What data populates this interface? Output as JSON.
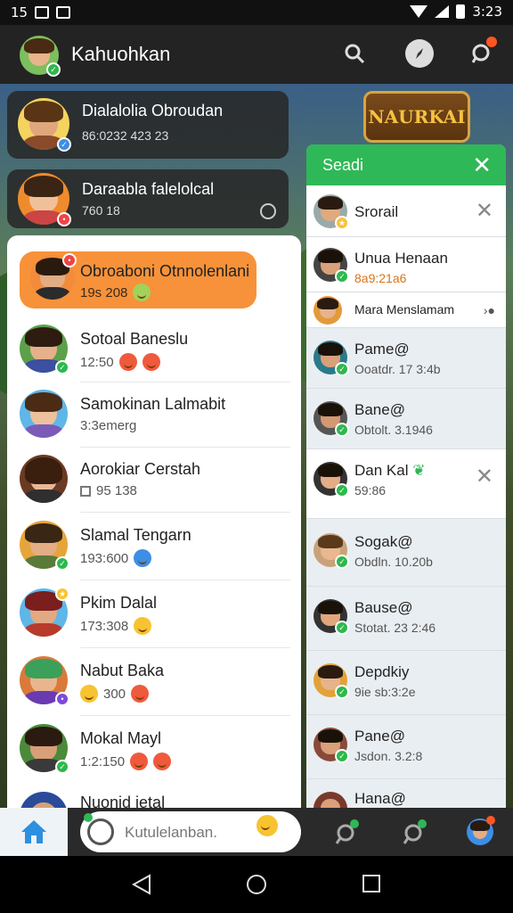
{
  "status": {
    "left_num": "15",
    "time": "3:23"
  },
  "appbar": {
    "title": "Kahuohkan"
  },
  "scene": {
    "sign_text": "NAURKAI"
  },
  "float_cards": [
    {
      "name": "Dialalolia Obroudan",
      "sub": "86:0232 423 23"
    },
    {
      "name": "Daraabla falelolcal",
      "sub": "760 18"
    }
  ],
  "chat_list": [
    {
      "name": "Obroaboni Otnnolenlani",
      "sub": "19s 208"
    },
    {
      "name": "Sotoal Baneslu",
      "sub": "12:50"
    },
    {
      "name": "Samokinan Lalmabit",
      "sub": "3:3emerg"
    },
    {
      "name": "Aorokiar Cerstah",
      "sub": "95 138"
    },
    {
      "name": "Slamal Tengarn",
      "sub": "193:600"
    },
    {
      "name": "Pkim Dalal",
      "sub": "173:308"
    },
    {
      "name": "Nabut Baka",
      "sub": "300"
    },
    {
      "name": "Mokal Mayl",
      "sub": "1:2:150"
    },
    {
      "name": "Nuonid ietal",
      "sub": ""
    }
  ],
  "search_panel": {
    "title": "Seadi",
    "results": [
      {
        "name": "Srorail",
        "sub": ""
      },
      {
        "name": "Unua Henaan",
        "sub": "8a9:21a6"
      },
      {
        "name": "Mara Menslamam",
        "sub": ""
      },
      {
        "name": "Pame@",
        "sub": "Ooatdr. 17 3:4b"
      },
      {
        "name": "Bane@",
        "sub": "Obtolt. 3.1946"
      },
      {
        "name": "Dan Kal",
        "sub": "59:86"
      },
      {
        "name": "Sogak@",
        "sub": "Obdln. 10.20b"
      },
      {
        "name": "Bause@",
        "sub": "Stotat. 23 2:46"
      },
      {
        "name": "Depdkiy",
        "sub": "9ie sb:3:2e"
      },
      {
        "name": "Pane@",
        "sub": "Jsdon. 3.2:8"
      },
      {
        "name": "Hana@",
        "sub": ""
      }
    ]
  },
  "composer": {
    "placeholder": "Kutulelanban."
  }
}
